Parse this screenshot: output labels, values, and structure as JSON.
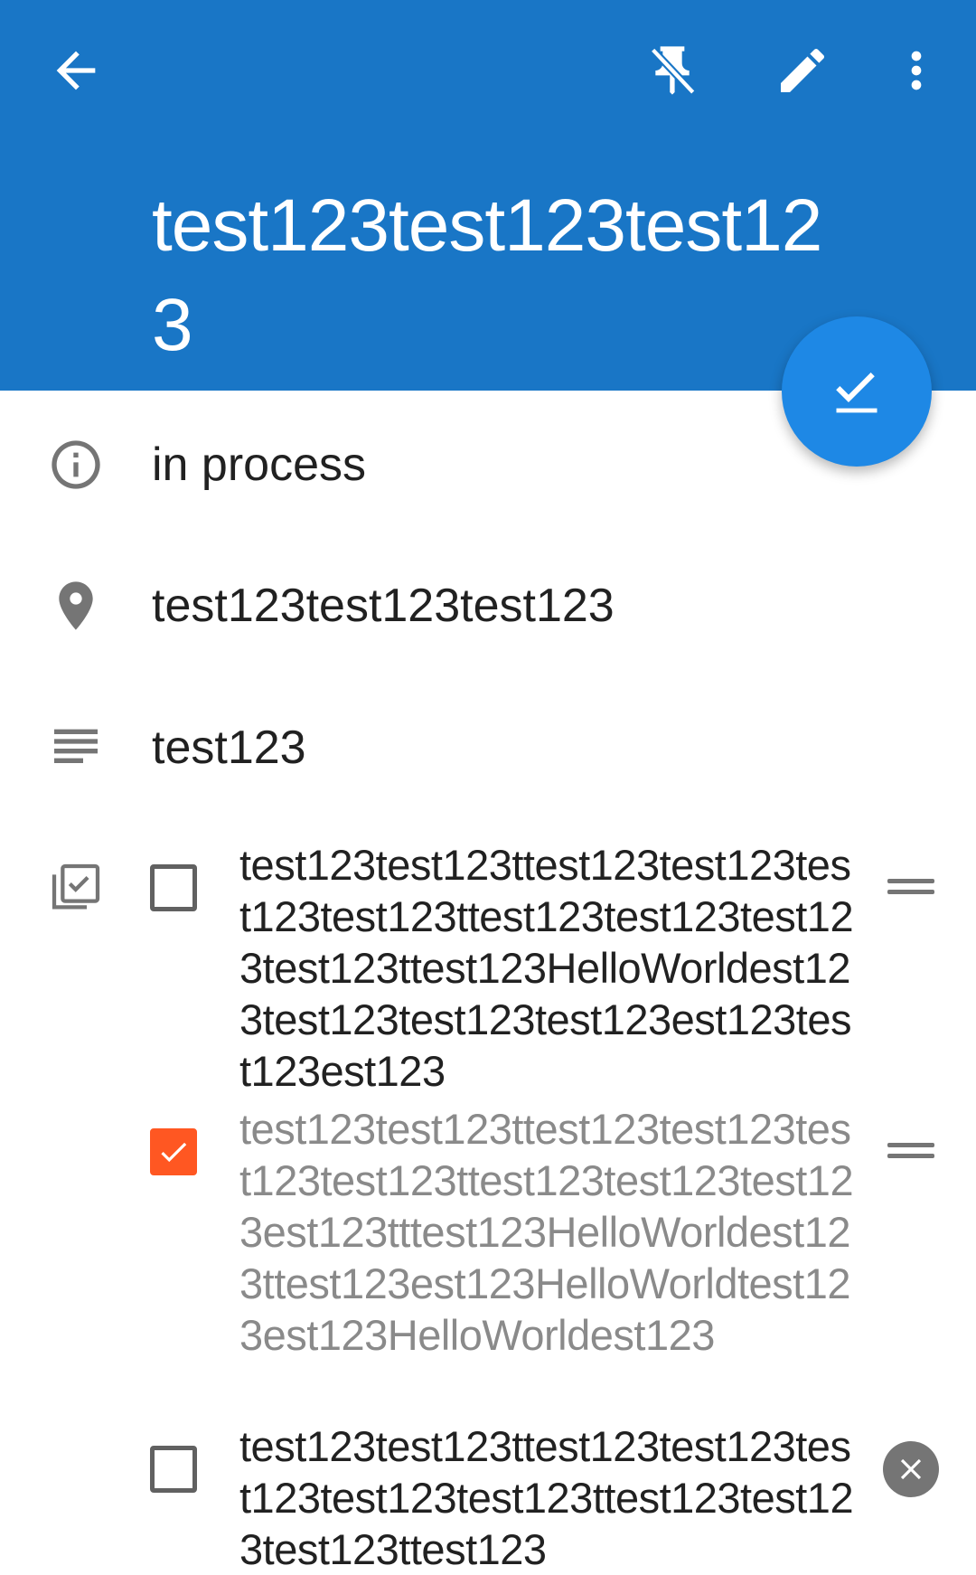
{
  "header": {
    "title": "test123test123test123",
    "background": "#1976c6",
    "icons": [
      "back-arrow-icon",
      "unpin-icon",
      "edit-pencil-icon",
      "more-vert-icon"
    ]
  },
  "fab": {
    "icon": "check-icon",
    "color": "#1e88e5"
  },
  "details": {
    "status": "in process",
    "location": "test123test123test123",
    "description": "test123"
  },
  "checklist": {
    "accent_color": "#ff5722",
    "items": [
      {
        "checked": false,
        "text": "test123test123ttest123test123test123test123ttest123test123test123test123ttest123HelloWorldest123test123test123test123est123test123est123"
      },
      {
        "checked": true,
        "text": "test123test123ttest123test123test123test123ttest123test123test123est123tttest123HelloWorldest123ttest123est123HelloWorldtest123est123HelloWorldest123"
      },
      {
        "checked": false,
        "text": "test123test123ttest123test123test123test123test123ttest123test123test123ttest123"
      }
    ]
  }
}
